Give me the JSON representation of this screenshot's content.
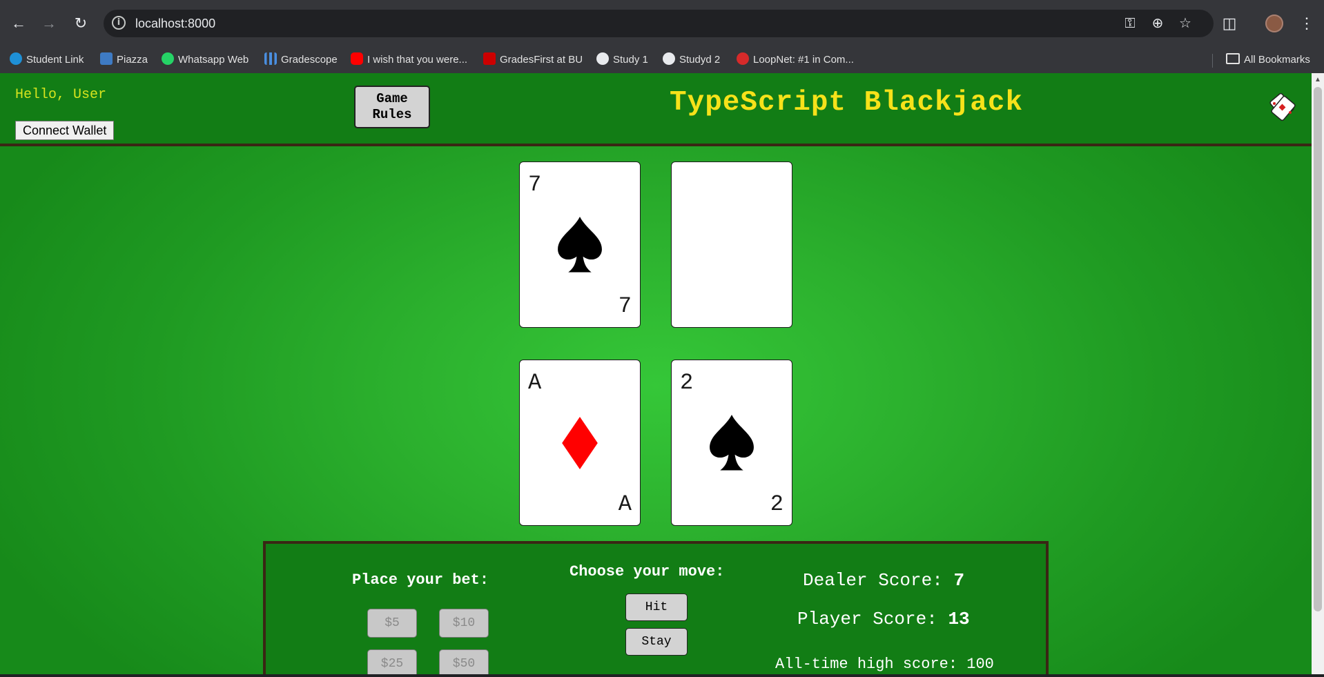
{
  "browser": {
    "url": "localhost:8000",
    "bookmarks": [
      {
        "label": "Student Link",
        "icon": "salesforce-cloud-icon",
        "color": "#1e90d6"
      },
      {
        "label": "Piazza",
        "icon": "piazza-icon",
        "color": "#3e7bc4"
      },
      {
        "label": "Whatsapp Web",
        "icon": "whatsapp-icon",
        "color": "#25d366"
      },
      {
        "label": "Gradescope",
        "icon": "gradescope-icon",
        "color": "#4a8fe0"
      },
      {
        "label": "I wish that you were...",
        "icon": "youtube-icon",
        "color": "#ff0000"
      },
      {
        "label": "GradesFirst at BU",
        "icon": "bu-icon",
        "color": "#cc0000"
      },
      {
        "label": "Study 1",
        "icon": "github-icon",
        "color": "#e8eaed"
      },
      {
        "label": "Studyd 2",
        "icon": "github-icon",
        "color": "#e8eaed"
      },
      {
        "label": "LoopNet: #1 in Com...",
        "icon": "loopnet-icon",
        "color": "#d62a2a"
      }
    ],
    "all_bookmarks_label": "All Bookmarks"
  },
  "header": {
    "greeting": "Hello, User",
    "connect_wallet": "Connect Wallet",
    "rules_line1": "Game",
    "rules_line2": "Rules",
    "title": "TypeScript Blackjack"
  },
  "dealer_cards": [
    {
      "rank": "7",
      "suit": "spades"
    },
    {
      "rank": "",
      "suit": "hidden"
    }
  ],
  "player_cards": [
    {
      "rank": "A",
      "suit": "diamonds"
    },
    {
      "rank": "2",
      "suit": "spades"
    }
  ],
  "panel": {
    "bet_heading": "Place your bet:",
    "bets": [
      "$5",
      "$10",
      "$25",
      "$50"
    ],
    "move_heading": "Choose your move:",
    "hit": "Hit",
    "stay": "Stay",
    "dealer_label": "Dealer Score:",
    "dealer_score": "7",
    "player_label": "Player Score:",
    "player_score": "13",
    "high_score_text": "All-time high score: 100"
  },
  "colors": {
    "felt": "#2cb12e",
    "header_green": "#127d15",
    "title_yellow": "#f6e21a",
    "greeting_yellow": "#d6e41e",
    "red_suit": "#ff0000"
  }
}
